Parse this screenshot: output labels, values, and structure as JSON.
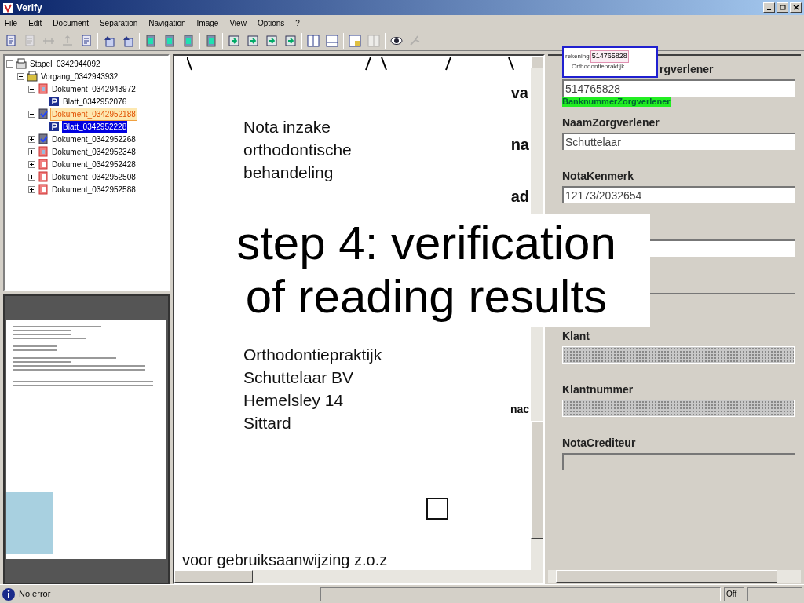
{
  "window": {
    "title": "Verify"
  },
  "menu": [
    "File",
    "Edit",
    "Document",
    "Separation",
    "Navigation",
    "Image",
    "View",
    "Options",
    "?"
  ],
  "toolbar": [
    {
      "kind": "page",
      "disabled": false
    },
    {
      "kind": "page",
      "disabled": true
    },
    {
      "kind": "split",
      "disabled": true
    },
    {
      "kind": "merge",
      "disabled": true
    },
    {
      "kind": "page",
      "disabled": false
    },
    {
      "kind": "sep"
    },
    {
      "kind": "up",
      "disabled": false
    },
    {
      "kind": "up",
      "disabled": false
    },
    {
      "kind": "sep"
    },
    {
      "kind": "green",
      "disabled": false
    },
    {
      "kind": "green",
      "disabled": false
    },
    {
      "kind": "green",
      "disabled": false
    },
    {
      "kind": "sep"
    },
    {
      "kind": "green",
      "disabled": false
    },
    {
      "kind": "sep"
    },
    {
      "kind": "arrow",
      "disabled": false
    },
    {
      "kind": "arrow",
      "disabled": false
    },
    {
      "kind": "arrow",
      "disabled": false
    },
    {
      "kind": "arrow",
      "disabled": false
    },
    {
      "kind": "sep"
    },
    {
      "kind": "columns",
      "disabled": false
    },
    {
      "kind": "rows",
      "disabled": false
    },
    {
      "kind": "sep"
    },
    {
      "kind": "grid",
      "disabled": false
    },
    {
      "kind": "columns",
      "disabled": true
    },
    {
      "kind": "sep"
    },
    {
      "kind": "eye",
      "disabled": false
    },
    {
      "kind": "tool",
      "disabled": true
    }
  ],
  "tree": [
    {
      "label": "Stapel_0342944092",
      "kind": "stack",
      "expanded": true,
      "selected": false,
      "highlighted": false,
      "children": [
        {
          "label": "Vorgang_0342943932",
          "kind": "folder",
          "expanded": true,
          "selected": false,
          "highlighted": false,
          "children": [
            {
              "label": "Dokument_0342943972",
              "kind": "document",
              "expanded": true,
              "selected": false,
              "highlighted": false,
              "children": [
                {
                  "label": "Blatt_0342952076",
                  "kind": "page",
                  "selected": false,
                  "highlighted": false
                }
              ]
            },
            {
              "label": "Dokument_0342952188",
              "kind": "checked",
              "expanded": true,
              "selected": false,
              "highlighted": true,
              "children": [
                {
                  "label": "Blatt_0342952228",
                  "kind": "page",
                  "selected": true,
                  "highlighted": false
                }
              ]
            },
            {
              "label": "Dokument_0342952268",
              "kind": "checked",
              "expanded": false,
              "selected": false,
              "highlighted": false
            },
            {
              "label": "Dokument_0342952348",
              "kind": "document",
              "expanded": false,
              "selected": false,
              "highlighted": false
            },
            {
              "label": "Dokument_0342952428",
              "kind": "blank",
              "expanded": false,
              "selected": false,
              "highlighted": false
            },
            {
              "label": "Dokument_0342952508",
              "kind": "blank",
              "expanded": false,
              "selected": false,
              "highlighted": false
            },
            {
              "label": "Dokument_0342952588",
              "kind": "blank",
              "expanded": false,
              "selected": false,
              "highlighted": false
            }
          ]
        }
      ]
    }
  ],
  "document": {
    "title_lines": [
      "Nota inzake",
      "orthodontische",
      "behandeling"
    ],
    "right_labels": [
      "va",
      "na",
      "ad"
    ],
    "address_lines": [
      "Orthodontiepraktijk",
      "Schuttelaar BV",
      "Hemelsley 14",
      "Sittard"
    ],
    "side_label": "nac",
    "footer": "voor gebruiksaanwijzing z.o.z"
  },
  "zoom_preview": {
    "label": "rekening",
    "value": "514765828",
    "caption": "Orthodontiepraktijk"
  },
  "fields": [
    {
      "label": "rgverlener",
      "value": "514765828",
      "kind": "input",
      "status": "BanknummerZorgverlener"
    },
    {
      "label": "NaamZorgverlener",
      "value": "Schuttelaar",
      "kind": "input"
    },
    {
      "label": "NotaKenmerk",
      "value": "12173/2032654",
      "kind": "input"
    },
    {
      "kind": "input"
    },
    {
      "kind": "disabled"
    },
    {
      "label": "Klant",
      "kind": "masked"
    },
    {
      "label": "Klantnummer",
      "kind": "masked"
    },
    {
      "label": "NotaCrediteur",
      "kind": "disabled"
    }
  ],
  "status_bar": {
    "message": "No error",
    "indicator": "Off"
  },
  "overlay": {
    "lines": [
      "step 4: verification",
      "of reading results"
    ]
  }
}
